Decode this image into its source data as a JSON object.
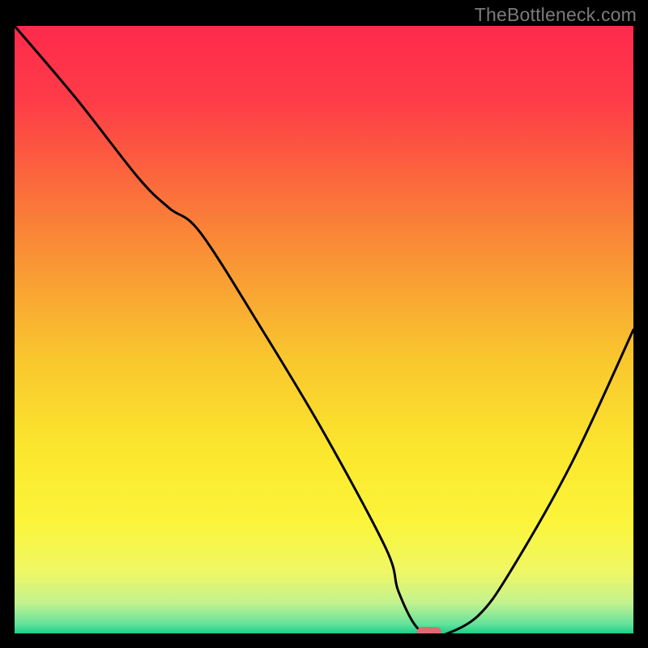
{
  "watermark": "TheBottleneck.com",
  "chart_data": {
    "type": "line",
    "title": "",
    "xlabel": "",
    "ylabel": "",
    "xlim": [
      0,
      100
    ],
    "ylim": [
      0,
      100
    ],
    "series": [
      {
        "name": "curve",
        "x": [
          0,
          10,
          20,
          25,
          30,
          40,
          50,
          60,
          62,
          65,
          68,
          70,
          75,
          80,
          90,
          100
        ],
        "y": [
          100,
          88,
          75,
          70,
          66,
          50,
          33,
          14,
          7,
          1,
          0,
          0,
          3,
          10,
          28,
          50
        ]
      }
    ],
    "marker": {
      "x": 67,
      "y": 0,
      "color": "#de6b72"
    },
    "gradient_stops": [
      {
        "offset": 0.0,
        "color": "#fe2a4c"
      },
      {
        "offset": 0.12,
        "color": "#fe3b48"
      },
      {
        "offset": 0.26,
        "color": "#fb6a3c"
      },
      {
        "offset": 0.4,
        "color": "#f99934"
      },
      {
        "offset": 0.55,
        "color": "#f9c72e"
      },
      {
        "offset": 0.7,
        "color": "#fbe72d"
      },
      {
        "offset": 0.82,
        "color": "#fbf53b"
      },
      {
        "offset": 0.9,
        "color": "#eef765"
      },
      {
        "offset": 0.95,
        "color": "#c3f28f"
      },
      {
        "offset": 0.985,
        "color": "#63e29b"
      },
      {
        "offset": 1.0,
        "color": "#19cf86"
      }
    ]
  }
}
